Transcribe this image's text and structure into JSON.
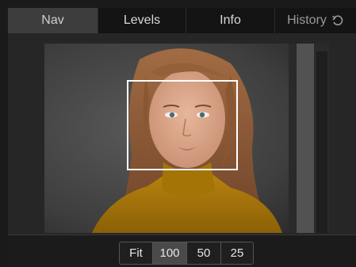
{
  "tabs": [
    {
      "label": "Nav",
      "active": true
    },
    {
      "label": "Levels",
      "active": false
    },
    {
      "label": "Info",
      "active": false
    },
    {
      "label": "History",
      "active": false,
      "icon": "undo-icon"
    }
  ],
  "zoom": {
    "options": [
      "Fit",
      "100",
      "50",
      "25"
    ],
    "selected": "100"
  },
  "colors": {
    "active_tab": "#3d3d3d",
    "viewport_rect": "#ffffff",
    "selected_zoom": "#4a4a4a"
  }
}
